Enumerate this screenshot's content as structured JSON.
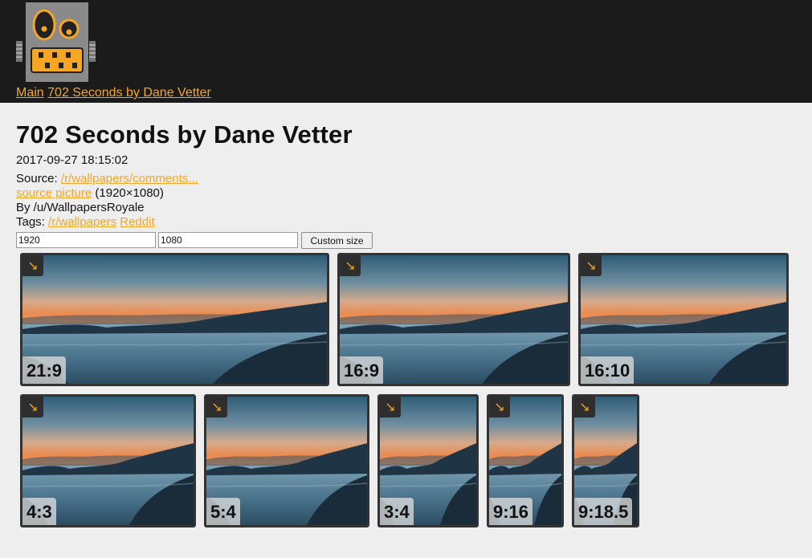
{
  "header": {
    "logo": "robot-logo",
    "breadcrumbs": [
      {
        "label": "Main"
      },
      {
        "label": "702 Seconds by Dane Vetter"
      }
    ]
  },
  "page": {
    "title": "702 Seconds by Dane Vetter",
    "date": "2017-09-27 18:15:02",
    "source_label": "Source: ",
    "source_link": "/r/wallpapers/comments...",
    "source_picture_link": "source picture",
    "source_picture_dims": " (1920×1080)",
    "author": "By /u/WallpapersRoyale",
    "tags_label": "Tags: ",
    "tags": [
      "/r/wallpapers",
      "Reddit"
    ]
  },
  "custom_size": {
    "width_value": "1920",
    "height_value": "1080",
    "button_label": "Custom size"
  },
  "thumbnails": [
    {
      "ratio": "21:9",
      "icon": "arrow-down-right-icon"
    },
    {
      "ratio": "16:9",
      "icon": "arrow-down-right-icon"
    },
    {
      "ratio": "16:10",
      "icon": "arrow-down-right-icon"
    },
    {
      "ratio": "4:3",
      "icon": "arrow-down-right-icon"
    },
    {
      "ratio": "5:4",
      "icon": "arrow-down-right-icon"
    },
    {
      "ratio": "3:4",
      "icon": "arrow-down-right-icon"
    },
    {
      "ratio": "9:16",
      "icon": "arrow-down-right-icon"
    },
    {
      "ratio": "9:18.5",
      "icon": "arrow-down-right-icon"
    }
  ],
  "colors": {
    "header_bg": "#1b1b1b",
    "link": "#f5a623",
    "page_bg": "#eeeeee",
    "thumb_border": "#333333"
  }
}
